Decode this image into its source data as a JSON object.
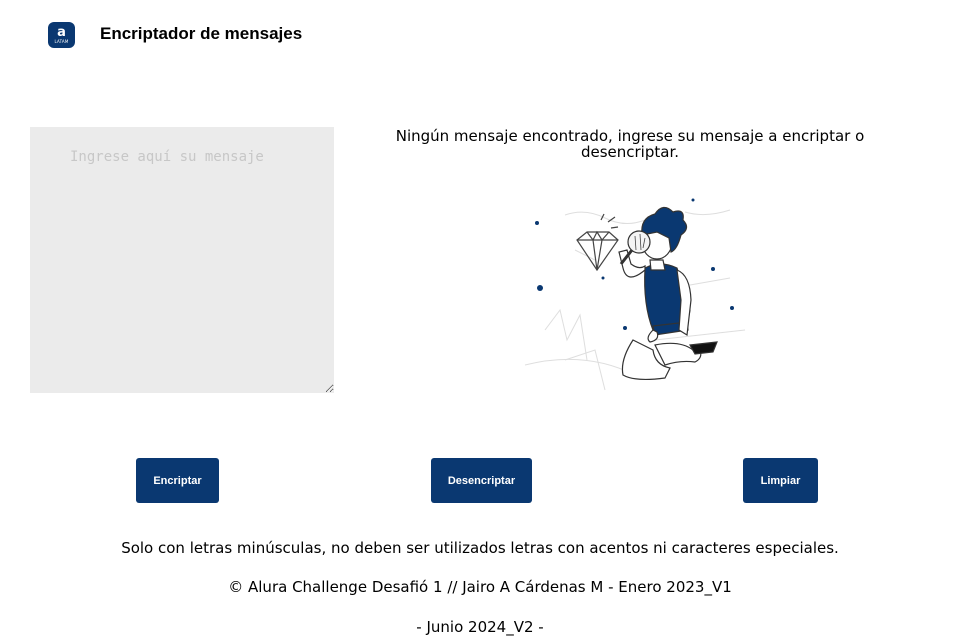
{
  "header": {
    "logo_glyph": "a",
    "logo_sub": "LATAM",
    "title": "Encriptador de mensajes"
  },
  "input": {
    "placeholder": "Ingrese aquí su mensaje",
    "value": ""
  },
  "output": {
    "empty_message": "Ningún mensaje encontrado, ingrese su mensaje a encriptar o desencriptar.",
    "illustration": "person-with-magnifier-illustration"
  },
  "buttons": {
    "encrypt": "Encriptar",
    "decrypt": "Desencriptar",
    "clear": "Limpiar"
  },
  "footer": {
    "rules": "Solo con letras minúsculas, no deben ser utilizados letras con acentos ni caracteres especiales.",
    "credits": "© Alura Challenge Desafió 1 // Jairo A Cárdenas M - Enero 2023_V1",
    "version": "- Junio 2024_V2 -"
  },
  "colors": {
    "primary": "#0a3871",
    "textarea_bg": "#ebebeb"
  }
}
